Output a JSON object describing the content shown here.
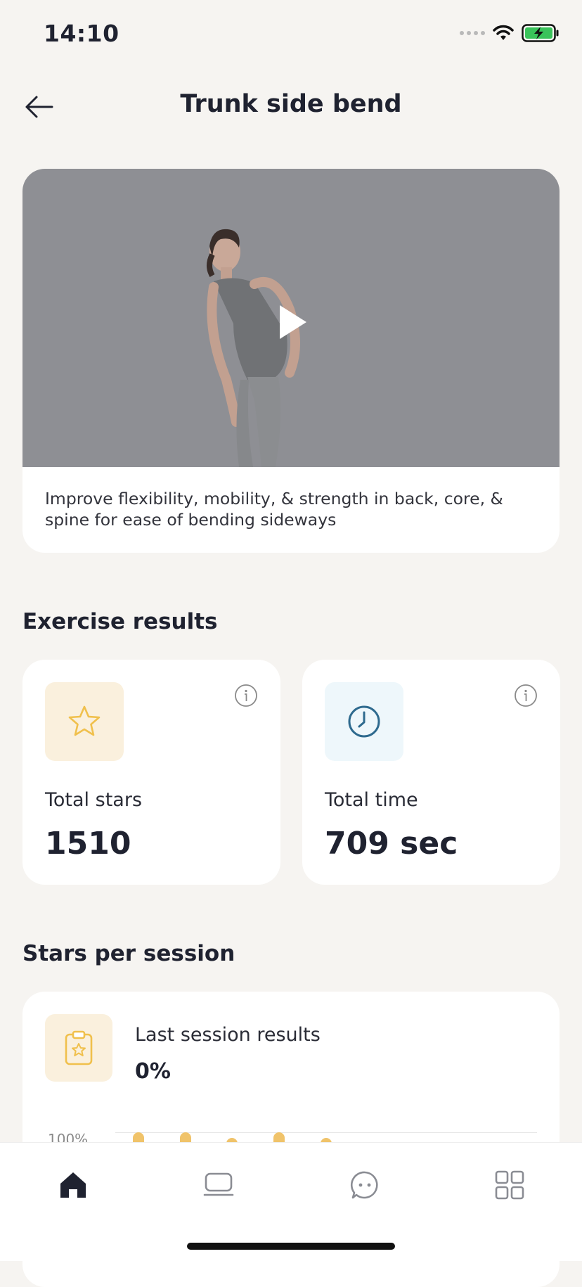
{
  "status_bar": {
    "time": "14:10"
  },
  "header": {
    "title": "Trunk side bend"
  },
  "video": {
    "description": "Improve flexibility, mobility, & strength in back, core, & spine for ease of bending sideways"
  },
  "exercise_results": {
    "title": "Exercise results",
    "total_stars": {
      "label": "Total stars",
      "value": "1510"
    },
    "total_time": {
      "label": "Total time",
      "value": "709 sec"
    }
  },
  "stars_per_session": {
    "title": "Stars per session",
    "last_session_label": "Last session results",
    "last_session_value": "0%",
    "chart_ylabel": "100%"
  },
  "colors": {
    "background": "#f6f4f1",
    "star_accent": "#f0c04c",
    "clock_accent": "#2e6a8e",
    "nav_active": "#1f2230"
  }
}
